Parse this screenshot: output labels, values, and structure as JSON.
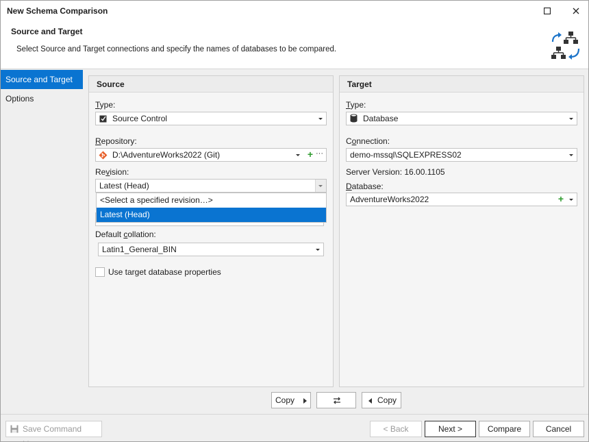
{
  "window": {
    "title": "New Schema Comparison"
  },
  "header": {
    "title": "Source and Target",
    "description": "Select Source and Target connections and specify the names of databases to be compared."
  },
  "nav": {
    "items": [
      {
        "label": "Source and Target",
        "active": true
      },
      {
        "label": "Options",
        "active": false
      }
    ]
  },
  "source": {
    "heading": "Source",
    "type_label": "Type:",
    "type_value": "Source Control",
    "repository_label": "Repository:",
    "repository_value": "D:\\AdventureWorks2022 (Git)",
    "revision_label": "Revision:",
    "revision_value": "Latest (Head)",
    "revision_options": [
      "<Select a specified revision…>",
      "Latest (Head)"
    ],
    "revision_selected_index": 1,
    "collation_label": "Default collation:",
    "collation_value": "Latin1_General_BIN",
    "use_target_label": "Use target database properties"
  },
  "target": {
    "heading": "Target",
    "type_label": "Type:",
    "type_value": "Database",
    "connection_label": "Connection:",
    "connection_value": "demo-mssql\\SQLEXPRESS02",
    "server_version_label": "Server Version: 16.00.1105",
    "database_label": "Database:",
    "database_value": "AdventureWorks2022"
  },
  "copy_bar": {
    "copy_right_label": "Copy",
    "copy_left_label": "Copy"
  },
  "footer": {
    "save_cmd_label": "Save Command Line...",
    "back_label": "< Back",
    "next_label": "Next >",
    "compare_label": "Compare",
    "cancel_label": "Cancel"
  },
  "colors": {
    "accent": "#0a74d1",
    "plus_green": "#2e9b2e"
  }
}
